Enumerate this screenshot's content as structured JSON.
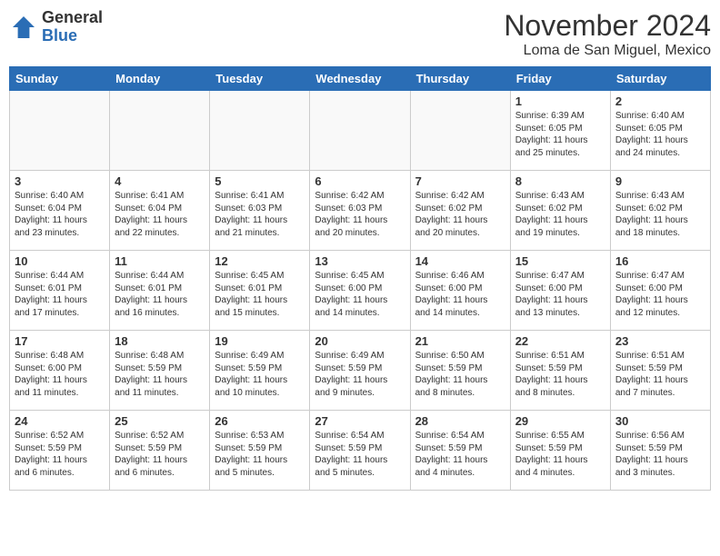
{
  "logo": {
    "general": "General",
    "blue": "Blue"
  },
  "title": "November 2024",
  "location": "Loma de San Miguel, Mexico",
  "weekdays": [
    "Sunday",
    "Monday",
    "Tuesday",
    "Wednesday",
    "Thursday",
    "Friday",
    "Saturday"
  ],
  "weeks": [
    [
      {
        "day": "",
        "info": ""
      },
      {
        "day": "",
        "info": ""
      },
      {
        "day": "",
        "info": ""
      },
      {
        "day": "",
        "info": ""
      },
      {
        "day": "",
        "info": ""
      },
      {
        "day": "1",
        "info": "Sunrise: 6:39 AM\nSunset: 6:05 PM\nDaylight: 11 hours\nand 25 minutes."
      },
      {
        "day": "2",
        "info": "Sunrise: 6:40 AM\nSunset: 6:05 PM\nDaylight: 11 hours\nand 24 minutes."
      }
    ],
    [
      {
        "day": "3",
        "info": "Sunrise: 6:40 AM\nSunset: 6:04 PM\nDaylight: 11 hours\nand 23 minutes."
      },
      {
        "day": "4",
        "info": "Sunrise: 6:41 AM\nSunset: 6:04 PM\nDaylight: 11 hours\nand 22 minutes."
      },
      {
        "day": "5",
        "info": "Sunrise: 6:41 AM\nSunset: 6:03 PM\nDaylight: 11 hours\nand 21 minutes."
      },
      {
        "day": "6",
        "info": "Sunrise: 6:42 AM\nSunset: 6:03 PM\nDaylight: 11 hours\nand 20 minutes."
      },
      {
        "day": "7",
        "info": "Sunrise: 6:42 AM\nSunset: 6:02 PM\nDaylight: 11 hours\nand 20 minutes."
      },
      {
        "day": "8",
        "info": "Sunrise: 6:43 AM\nSunset: 6:02 PM\nDaylight: 11 hours\nand 19 minutes."
      },
      {
        "day": "9",
        "info": "Sunrise: 6:43 AM\nSunset: 6:02 PM\nDaylight: 11 hours\nand 18 minutes."
      }
    ],
    [
      {
        "day": "10",
        "info": "Sunrise: 6:44 AM\nSunset: 6:01 PM\nDaylight: 11 hours\nand 17 minutes."
      },
      {
        "day": "11",
        "info": "Sunrise: 6:44 AM\nSunset: 6:01 PM\nDaylight: 11 hours\nand 16 minutes."
      },
      {
        "day": "12",
        "info": "Sunrise: 6:45 AM\nSunset: 6:01 PM\nDaylight: 11 hours\nand 15 minutes."
      },
      {
        "day": "13",
        "info": "Sunrise: 6:45 AM\nSunset: 6:00 PM\nDaylight: 11 hours\nand 14 minutes."
      },
      {
        "day": "14",
        "info": "Sunrise: 6:46 AM\nSunset: 6:00 PM\nDaylight: 11 hours\nand 14 minutes."
      },
      {
        "day": "15",
        "info": "Sunrise: 6:47 AM\nSunset: 6:00 PM\nDaylight: 11 hours\nand 13 minutes."
      },
      {
        "day": "16",
        "info": "Sunrise: 6:47 AM\nSunset: 6:00 PM\nDaylight: 11 hours\nand 12 minutes."
      }
    ],
    [
      {
        "day": "17",
        "info": "Sunrise: 6:48 AM\nSunset: 6:00 PM\nDaylight: 11 hours\nand 11 minutes."
      },
      {
        "day": "18",
        "info": "Sunrise: 6:48 AM\nSunset: 5:59 PM\nDaylight: 11 hours\nand 11 minutes."
      },
      {
        "day": "19",
        "info": "Sunrise: 6:49 AM\nSunset: 5:59 PM\nDaylight: 11 hours\nand 10 minutes."
      },
      {
        "day": "20",
        "info": "Sunrise: 6:49 AM\nSunset: 5:59 PM\nDaylight: 11 hours\nand 9 minutes."
      },
      {
        "day": "21",
        "info": "Sunrise: 6:50 AM\nSunset: 5:59 PM\nDaylight: 11 hours\nand 8 minutes."
      },
      {
        "day": "22",
        "info": "Sunrise: 6:51 AM\nSunset: 5:59 PM\nDaylight: 11 hours\nand 8 minutes."
      },
      {
        "day": "23",
        "info": "Sunrise: 6:51 AM\nSunset: 5:59 PM\nDaylight: 11 hours\nand 7 minutes."
      }
    ],
    [
      {
        "day": "24",
        "info": "Sunrise: 6:52 AM\nSunset: 5:59 PM\nDaylight: 11 hours\nand 6 minutes."
      },
      {
        "day": "25",
        "info": "Sunrise: 6:52 AM\nSunset: 5:59 PM\nDaylight: 11 hours\nand 6 minutes."
      },
      {
        "day": "26",
        "info": "Sunrise: 6:53 AM\nSunset: 5:59 PM\nDaylight: 11 hours\nand 5 minutes."
      },
      {
        "day": "27",
        "info": "Sunrise: 6:54 AM\nSunset: 5:59 PM\nDaylight: 11 hours\nand 5 minutes."
      },
      {
        "day": "28",
        "info": "Sunrise: 6:54 AM\nSunset: 5:59 PM\nDaylight: 11 hours\nand 4 minutes."
      },
      {
        "day": "29",
        "info": "Sunrise: 6:55 AM\nSunset: 5:59 PM\nDaylight: 11 hours\nand 4 minutes."
      },
      {
        "day": "30",
        "info": "Sunrise: 6:56 AM\nSunset: 5:59 PM\nDaylight: 11 hours\nand 3 minutes."
      }
    ]
  ]
}
